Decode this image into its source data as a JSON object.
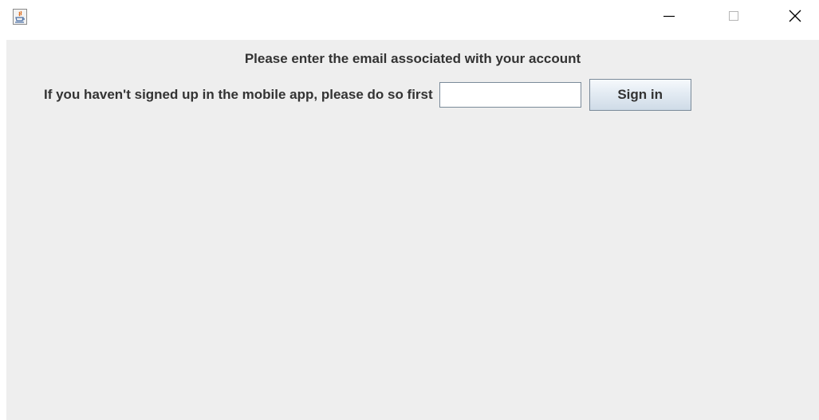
{
  "titlebar": {
    "app_icon": "java-icon",
    "controls": {
      "minimize_icon": "minimize-icon",
      "maximize_icon": "maximize-icon",
      "close_icon": "close-icon"
    }
  },
  "main": {
    "heading": "Please enter the email associated with your account",
    "prompt": "If you haven't signed up in the mobile app, please do so first",
    "email_value": "",
    "signin_label": "Sign in"
  }
}
